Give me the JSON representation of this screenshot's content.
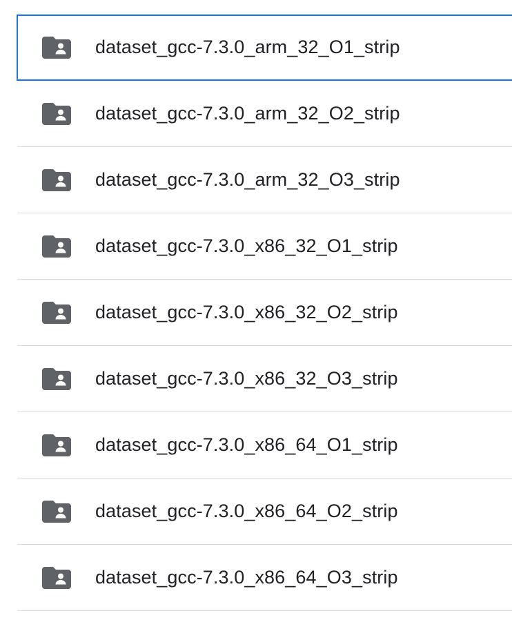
{
  "file_list": {
    "items": [
      {
        "name": "dataset_gcc-7.3.0_arm_32_O1_strip",
        "icon": "shared-folder-icon",
        "selected": true
      },
      {
        "name": "dataset_gcc-7.3.0_arm_32_O2_strip",
        "icon": "shared-folder-icon",
        "selected": false
      },
      {
        "name": "dataset_gcc-7.3.0_arm_32_O3_strip",
        "icon": "shared-folder-icon",
        "selected": false
      },
      {
        "name": "dataset_gcc-7.3.0_x86_32_O1_strip",
        "icon": "shared-folder-icon",
        "selected": false
      },
      {
        "name": "dataset_gcc-7.3.0_x86_32_O2_strip",
        "icon": "shared-folder-icon",
        "selected": false
      },
      {
        "name": "dataset_gcc-7.3.0_x86_32_O3_strip",
        "icon": "shared-folder-icon",
        "selected": false
      },
      {
        "name": "dataset_gcc-7.3.0_x86_64_O1_strip",
        "icon": "shared-folder-icon",
        "selected": false
      },
      {
        "name": "dataset_gcc-7.3.0_x86_64_O2_strip",
        "icon": "shared-folder-icon",
        "selected": false
      },
      {
        "name": "dataset_gcc-7.3.0_x86_64_O3_strip",
        "icon": "shared-folder-icon",
        "selected": false
      }
    ]
  },
  "colors": {
    "icon": "#5f6368",
    "text": "#202124",
    "divider": "#dadce0",
    "selection_border": "#1a73e8"
  }
}
